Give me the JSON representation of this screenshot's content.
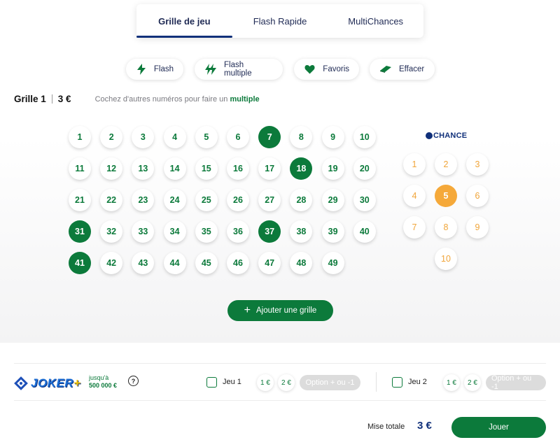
{
  "tabs": [
    {
      "label": "Grille de jeu",
      "active": true
    },
    {
      "label": "Flash Rapide",
      "active": false
    },
    {
      "label": "MultiChances",
      "active": false
    }
  ],
  "actions": {
    "flash": "Flash",
    "flash_multiple": "Flash multiple",
    "favoris": "Favoris",
    "effacer": "Effacer"
  },
  "grid": {
    "title": "Grille 1",
    "price": "3 €",
    "hint_prefix": "Cochez d'autres numéros pour faire un",
    "hint_link": "multiple",
    "numbers": [
      1,
      2,
      3,
      4,
      5,
      6,
      7,
      8,
      9,
      10,
      11,
      12,
      13,
      14,
      15,
      16,
      17,
      18,
      19,
      20,
      21,
      22,
      23,
      24,
      25,
      26,
      27,
      28,
      29,
      30,
      31,
      32,
      33,
      34,
      35,
      36,
      37,
      38,
      39,
      40,
      41,
      42,
      43,
      44,
      45,
      46,
      47,
      48,
      49
    ],
    "selected": [
      7,
      18,
      31,
      37,
      41
    ],
    "chance_logo": "CHANCE",
    "chance_numbers": [
      1,
      2,
      3,
      4,
      5,
      6,
      7,
      8,
      9,
      10
    ],
    "chance_selected": [
      5
    ],
    "add_grid_label": "Ajouter une grille"
  },
  "joker": {
    "logo_text": "JOKER",
    "logo_plus": "+",
    "up_to_label": "jusqu'à",
    "up_to_amount": "500 000 €",
    "help": "?",
    "game1": {
      "label": "Jeu 1",
      "stake1": "1 €",
      "stake2": "2 €",
      "option": "Option + ou -1"
    },
    "game2": {
      "label": "Jeu 2",
      "stake1": "1 €",
      "stake2": "2 €",
      "option": "Option + ou -1"
    }
  },
  "footer": {
    "mise_label": "Mise totale",
    "mise_value": "3 €",
    "play_label": "Jouer"
  },
  "colors": {
    "green": "#0c7a3b",
    "navy": "#10307a",
    "chance_orange": "#f5a93a"
  }
}
